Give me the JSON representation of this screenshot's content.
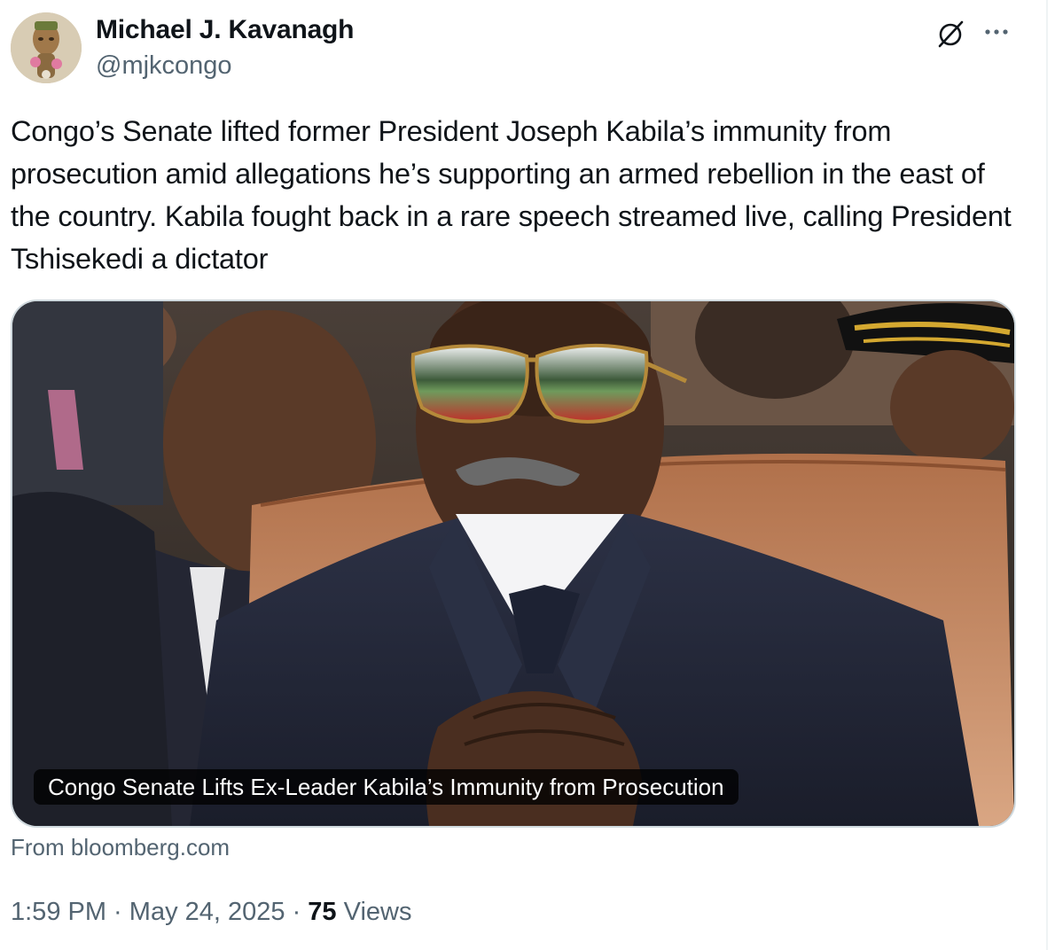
{
  "author": {
    "name": "Michael J. Kavanagh",
    "handle": "@mjkcongo"
  },
  "icons": {
    "grok": "grok-slash-icon",
    "more": "more-dots-icon"
  },
  "tweet": {
    "text": "Congo’s Senate lifted former President Joseph Kabila’s immunity from prosecution amid allegations he’s supporting an armed rebellion in the east of the country. Kabila fought back in a rare speech streamed live, calling President Tshisekedi a dictator"
  },
  "card": {
    "title": "Congo Senate Lifts Ex-Leader Kabila’s Immunity from Prosecution",
    "source": "From bloomberg.com"
  },
  "meta": {
    "time": "1:59 PM",
    "separator": " · ",
    "date": "May 24, 2025",
    "views_count": "75",
    "views_label": " Views"
  },
  "colors": {
    "text_primary": "#0f1419",
    "text_secondary": "#536471",
    "border": "#cfd9de"
  }
}
